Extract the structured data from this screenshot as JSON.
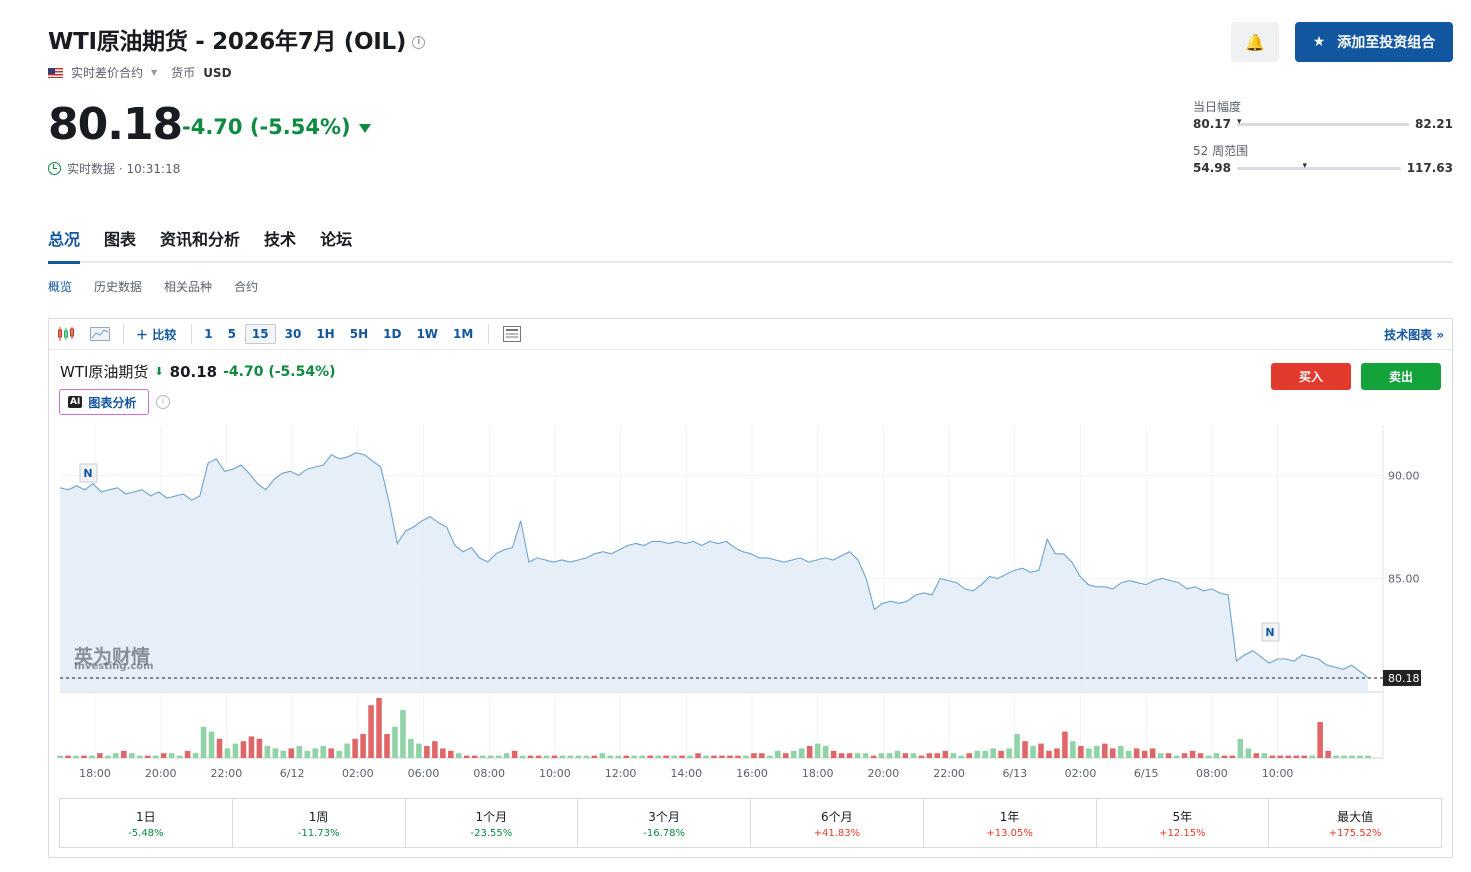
{
  "header": {
    "title": "WTI原油期货 - 2026年7月 (OIL)",
    "contract_type": "实时差价合约",
    "currency_label": "货币",
    "currency": "USD",
    "price": "80.18",
    "change": "-4.70 (-5.54%)",
    "realtime": "实时数据 · 10:31:18",
    "add_portfolio": "添加至投资组合"
  },
  "ranges": {
    "day_label": "当日幅度",
    "day_low": "80.17",
    "day_high": "82.21",
    "day_pos": 0.0,
    "week52_label": "52 周范围",
    "w52_low": "54.98",
    "w52_high": "117.63",
    "w52_pos": 0.4
  },
  "tabs": [
    "总况",
    "图表",
    "资讯和分析",
    "技术",
    "论坛"
  ],
  "subtabs": [
    "概览",
    "历史数据",
    "相关品种",
    "合约"
  ],
  "toolbar": {
    "compare": "比较",
    "intervals": [
      "1",
      "5",
      "15",
      "30",
      "1H",
      "5H",
      "1D",
      "1W",
      "1M"
    ],
    "selected": "15",
    "tech_chart": "技术图表 »"
  },
  "chart_header": {
    "name": "WTI原油期货",
    "price": "80.18",
    "change": "-4.70 (-5.54%)",
    "ai_label": "图表分析",
    "ai_badge": "AI",
    "buy": "买入",
    "sell": "卖出",
    "watermark": "英为财情",
    "watermark_sub": "Investing.com"
  },
  "chart_data": {
    "type": "area",
    "ylim": [
      79.5,
      92.2
    ],
    "yticks": [
      "90.00",
      "85.00"
    ],
    "ytick_values": [
      90,
      85
    ],
    "last_price": 80.18,
    "last_label": "80.18",
    "xlabels": [
      "18:00",
      "20:00",
      "22:00",
      "6/12",
      "02:00",
      "06:00",
      "08:00",
      "10:00",
      "12:00",
      "14:00",
      "16:00",
      "18:00",
      "20:00",
      "22:00",
      "6/13",
      "02:00",
      "6/15",
      "08:00",
      "10:00"
    ],
    "news_markers": [
      "N",
      "N"
    ],
    "values": [
      89.4,
      89.3,
      89.5,
      89.3,
      89.6,
      89.2,
      89.3,
      89.4,
      89.1,
      89.2,
      89.3,
      89.0,
      89.2,
      88.9,
      89.0,
      89.1,
      88.8,
      89.0,
      90.6,
      90.8,
      90.2,
      90.3,
      90.5,
      90.1,
      89.6,
      89.3,
      89.8,
      90.1,
      90.2,
      90.0,
      90.3,
      90.4,
      90.5,
      91.0,
      90.8,
      90.9,
      91.1,
      91.0,
      90.7,
      90.4,
      88.7,
      86.7,
      87.3,
      87.5,
      87.8,
      88.0,
      87.7,
      87.5,
      86.6,
      86.3,
      86.5,
      86.0,
      85.8,
      86.2,
      86.4,
      86.5,
      87.8,
      85.8,
      86.0,
      85.9,
      85.8,
      85.9,
      85.8,
      85.9,
      86.0,
      86.2,
      86.3,
      86.2,
      86.4,
      86.6,
      86.7,
      86.6,
      86.8,
      86.8,
      86.7,
      86.8,
      86.7,
      86.8,
      86.6,
      86.8,
      86.7,
      86.8,
      86.5,
      86.3,
      86.2,
      86.0,
      86.0,
      85.9,
      85.8,
      85.9,
      86.0,
      85.8,
      85.9,
      86.0,
      85.9,
      86.1,
      86.3,
      85.9,
      85.0,
      83.5,
      83.8,
      83.9,
      83.8,
      83.9,
      84.2,
      84.3,
      84.2,
      85.0,
      84.9,
      84.8,
      84.5,
      84.4,
      84.7,
      85.1,
      85.0,
      85.2,
      85.4,
      85.5,
      85.3,
      85.4,
      86.9,
      86.2,
      86.2,
      85.8,
      85.1,
      84.7,
      84.6,
      84.6,
      84.5,
      84.8,
      84.9,
      84.8,
      84.7,
      84.9,
      85.0,
      84.9,
      84.8,
      84.5,
      84.6,
      84.4,
      84.5,
      84.3,
      84.2,
      81.0,
      81.3,
      81.5,
      81.2,
      80.9,
      81.1,
      81.1,
      81.0,
      81.3,
      81.2,
      81.1,
      80.8,
      80.7,
      80.6,
      80.8,
      80.5,
      80.2
    ],
    "volume": [
      1,
      1,
      1,
      1,
      1,
      2,
      1,
      2,
      3,
      2,
      1,
      1,
      1,
      2,
      2,
      1,
      3,
      2,
      13,
      11,
      8,
      4,
      6,
      7,
      9,
      8,
      5,
      4,
      3,
      4,
      5,
      3,
      4,
      5,
      4,
      3,
      6,
      8,
      10,
      22,
      25,
      10,
      13,
      20,
      8,
      6,
      5,
      7,
      4,
      3,
      2,
      1,
      1,
      1,
      1,
      1,
      2,
      3,
      1,
      1,
      1,
      1,
      1,
      1,
      1,
      1,
      1,
      1,
      2,
      1,
      1,
      1,
      1,
      1,
      1,
      1,
      1,
      1,
      1,
      1,
      2,
      1,
      1,
      1,
      1,
      1,
      1,
      2,
      2,
      1,
      3,
      2,
      3,
      4,
      5,
      6,
      5,
      3,
      2,
      2,
      2,
      2,
      1,
      2,
      2,
      3,
      2,
      2,
      1,
      2,
      2,
      3,
      2,
      1,
      2,
      3,
      3,
      4,
      3,
      4,
      10,
      7,
      5,
      6,
      3,
      4,
      11,
      7,
      5,
      4,
      5,
      6,
      4,
      5,
      3,
      4,
      3,
      4,
      2,
      2,
      1,
      2,
      3,
      2,
      1,
      2,
      1,
      1,
      8,
      4,
      2,
      2,
      1,
      1,
      1,
      1,
      1,
      1,
      15,
      3,
      1,
      1,
      1,
      1,
      1
    ],
    "volume_colors": "alternating"
  },
  "performance": [
    {
      "period": "1日",
      "value": "-5.48%"
    },
    {
      "period": "1周",
      "value": "-11.73%"
    },
    {
      "period": "1个月",
      "value": "-23.55%"
    },
    {
      "period": "3个月",
      "value": "-16.78%"
    },
    {
      "period": "6个月",
      "value": "+41.83%"
    },
    {
      "period": "1年",
      "value": "+13.05%"
    },
    {
      "period": "5年",
      "value": "+12.15%"
    },
    {
      "period": "最大值",
      "value": "+175.52%"
    }
  ],
  "colors": {
    "accent": "#1256a0",
    "up": "#0e8a41",
    "down": "#e23b2e",
    "line": "#6fa3cf",
    "fill": "#e3edf6"
  }
}
